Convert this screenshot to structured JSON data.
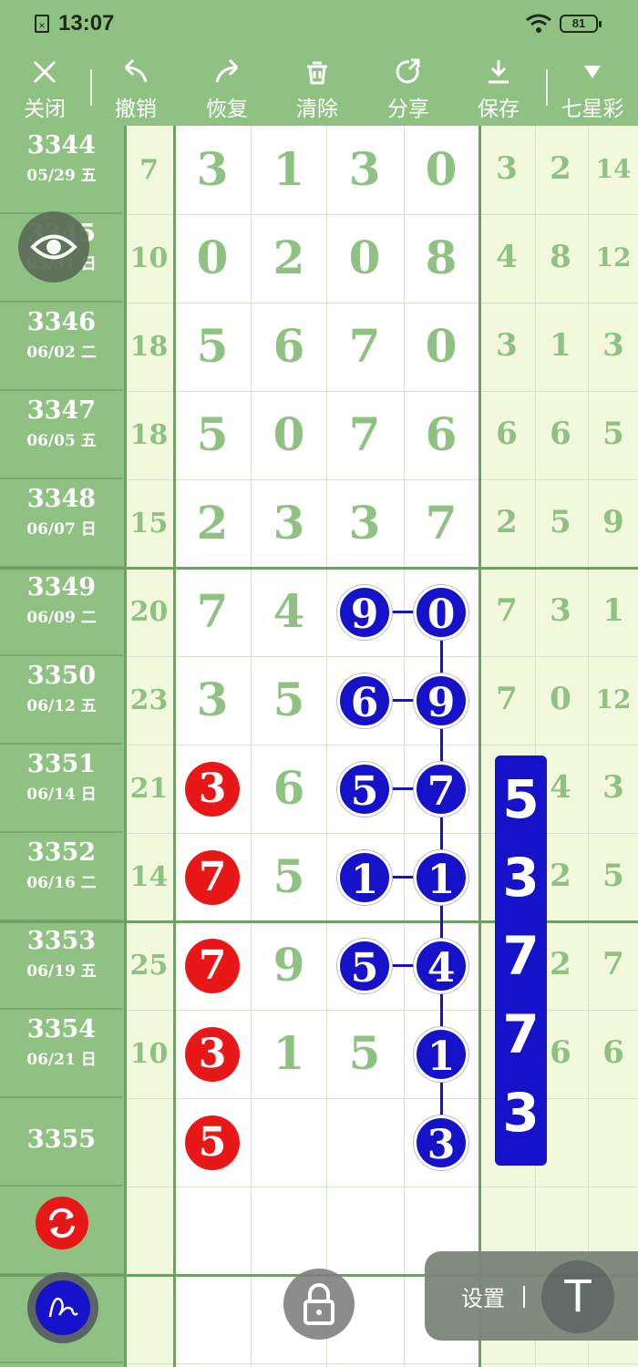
{
  "status_bar": {
    "time": "13:07",
    "battery": "81",
    "sim_icon": "sim-off-icon",
    "wifi_icon": "wifi-icon"
  },
  "toolbar": {
    "items": [
      {
        "label": "关闭",
        "icon": "close-icon"
      },
      {
        "label": "撤销",
        "icon": "undo-icon"
      },
      {
        "label": "恢复",
        "icon": "redo-icon"
      },
      {
        "label": "清除",
        "icon": "clear-icon"
      },
      {
        "label": "分享",
        "icon": "share-icon"
      },
      {
        "label": "保存",
        "icon": "save-icon"
      },
      {
        "label": "七星彩",
        "icon": "dropdown-icon"
      }
    ]
  },
  "rows": [
    {
      "period": "3344",
      "date": "05/29 五",
      "sum": "7",
      "digits": [
        "3",
        "1",
        "3",
        "0"
      ],
      "extra": [
        "3",
        "2",
        "14"
      ]
    },
    {
      "period": "3345",
      "date": "05/31 日",
      "sum": "10",
      "digits": [
        "0",
        "2",
        "0",
        "8"
      ],
      "extra": [
        "4",
        "8",
        "12"
      ]
    },
    {
      "period": "3346",
      "date": "06/02 二",
      "sum": "18",
      "digits": [
        "5",
        "6",
        "7",
        "0"
      ],
      "extra": [
        "3",
        "1",
        "3"
      ]
    },
    {
      "period": "3347",
      "date": "06/05 五",
      "sum": "18",
      "digits": [
        "5",
        "0",
        "7",
        "6"
      ],
      "extra": [
        "6",
        "6",
        "5"
      ]
    },
    {
      "period": "3348",
      "date": "06/07 日",
      "sum": "15",
      "digits": [
        "2",
        "3",
        "3",
        "7"
      ],
      "extra": [
        "2",
        "5",
        "9"
      ]
    },
    {
      "period": "3349",
      "date": "06/09 二",
      "sum": "20",
      "digits": [
        "7",
        "4",
        "9",
        "0"
      ],
      "extra": [
        "7",
        "3",
        "1"
      ]
    },
    {
      "period": "3350",
      "date": "06/12 五",
      "sum": "23",
      "digits": [
        "3",
        "5",
        "6",
        "9"
      ],
      "extra": [
        "7",
        "0",
        "12"
      ]
    },
    {
      "period": "3351",
      "date": "06/14 日",
      "sum": "21",
      "digits": [
        "3",
        "6",
        "5",
        "7"
      ],
      "extra": [
        "",
        "4",
        "3"
      ]
    },
    {
      "period": "3352",
      "date": "06/16 二",
      "sum": "14",
      "digits": [
        "7",
        "5",
        "1",
        "1"
      ],
      "extra": [
        "",
        "2",
        "5"
      ]
    },
    {
      "period": "3353",
      "date": "06/19 五",
      "sum": "25",
      "digits": [
        "7",
        "9",
        "5",
        "4"
      ],
      "extra": [
        "",
        "2",
        "7"
      ]
    },
    {
      "period": "3354",
      "date": "06/21 日",
      "sum": "10",
      "digits": [
        "3",
        "1",
        "5",
        "1"
      ],
      "extra": [
        "",
        "6",
        "6"
      ]
    },
    {
      "period": "3355",
      "date": "",
      "sum": "",
      "digits": [
        "5",
        "",
        "",
        "3"
      ],
      "extra": [
        "",
        "",
        ""
      ]
    }
  ],
  "marks": {
    "red": [
      [
        7,
        0
      ],
      [
        8,
        0
      ],
      [
        9,
        0
      ],
      [
        10,
        0
      ],
      [
        11,
        0
      ]
    ],
    "blue": [
      [
        5,
        2
      ],
      [
        5,
        3
      ],
      [
        6,
        2
      ],
      [
        6,
        3
      ],
      [
        7,
        2
      ],
      [
        7,
        3
      ],
      [
        8,
        2
      ],
      [
        8,
        3
      ],
      [
        9,
        2
      ],
      [
        9,
        3
      ],
      [
        10,
        3
      ],
      [
        11,
        3
      ]
    ]
  },
  "overlay_digits": [
    "5",
    "3",
    "7",
    "7",
    "3"
  ],
  "floating": {
    "settings_label": "设置",
    "t_button": "T",
    "eye_icon": "eye-icon",
    "refresh_icon": "refresh-icon",
    "pen_icon": "pen-icon",
    "lock_icon": "lock-icon"
  },
  "colors": {
    "theme_green": "#8fc282",
    "ball_blue": "#1512c9",
    "ball_red": "#e81818",
    "light_col": "#f1f8dc"
  }
}
